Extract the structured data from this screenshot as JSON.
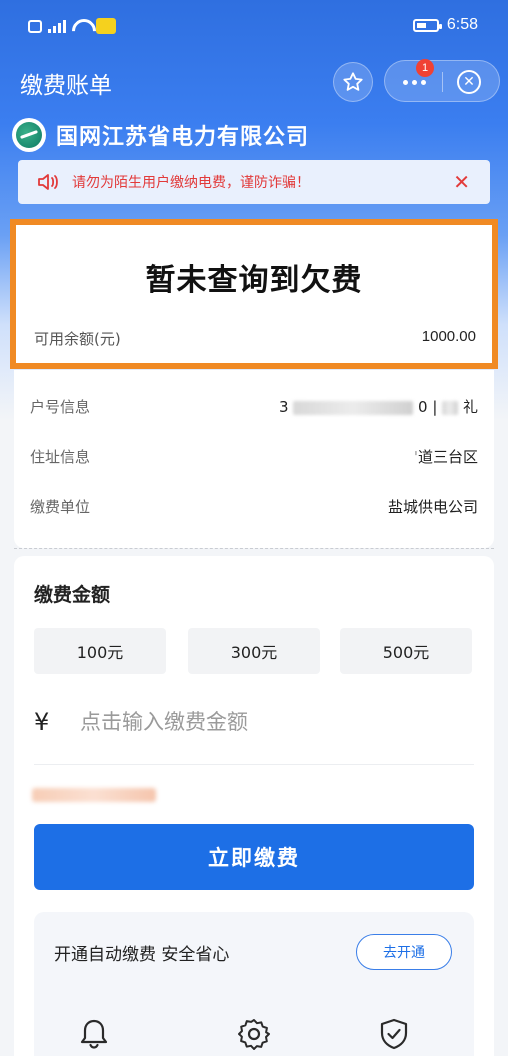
{
  "status_bar": {
    "time": "6:58"
  },
  "header": {
    "title": "缴费账单",
    "badge_count": "1"
  },
  "company": {
    "name": "国网江苏省电力有限公司"
  },
  "warning": {
    "text": "请勿为陌生用户缴纳电费，谨防诈骗！",
    "close_icon": "close-icon"
  },
  "balance": {
    "title": "暂未查询到欠费",
    "label": "可用余额(元)",
    "value": "1000.00"
  },
  "info": {
    "rows": [
      {
        "label": "户号信息",
        "value_prefix": "3",
        "value_mid": "0 |",
        "value_suffix": "礼"
      },
      {
        "label": "住址信息",
        "value": "道三台区"
      },
      {
        "label": "缴费单位",
        "value": "盐城供电公司"
      }
    ]
  },
  "payment": {
    "title": "缴费金额",
    "options": [
      "100元",
      "300元",
      "500元"
    ],
    "currency_symbol": "¥",
    "input_placeholder": "点击输入缴费金额",
    "pay_button": "立即缴费"
  },
  "auto_pay": {
    "text": "开通自动缴费 安全省心",
    "button": "去开通"
  },
  "colors": {
    "primary": "#1d6fe6",
    "highlight_border": "#f08a24",
    "warning_text": "#e23a3a"
  }
}
